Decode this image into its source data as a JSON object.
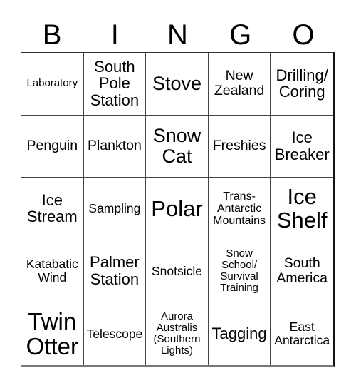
{
  "header": {
    "letters": [
      "B",
      "I",
      "N",
      "G",
      "O"
    ]
  },
  "card": {
    "cells": [
      "Laboratory",
      "South\nPole\nStation",
      "Stove",
      "New\nZealand",
      "Drilling/\nCoring",
      "Penguin",
      "Plankton",
      "Snow\nCat",
      "Freshies",
      "Ice\nBreaker",
      "Ice\nStream",
      "Sampling",
      "Polar",
      "Trans-\nAntarctic\nMountains",
      "Ice\nShelf",
      "Katabatic\nWind",
      "Palmer\nStation",
      "Snotsicle",
      "Snow\nSchool/\nSurvival\nTraining",
      "South\nAmerica",
      "Twin\nOtter",
      "Telescope",
      "Aurora\nAustralis\n(Southern\nLights)",
      "Tagging",
      "East\nAntarctica"
    ]
  }
}
